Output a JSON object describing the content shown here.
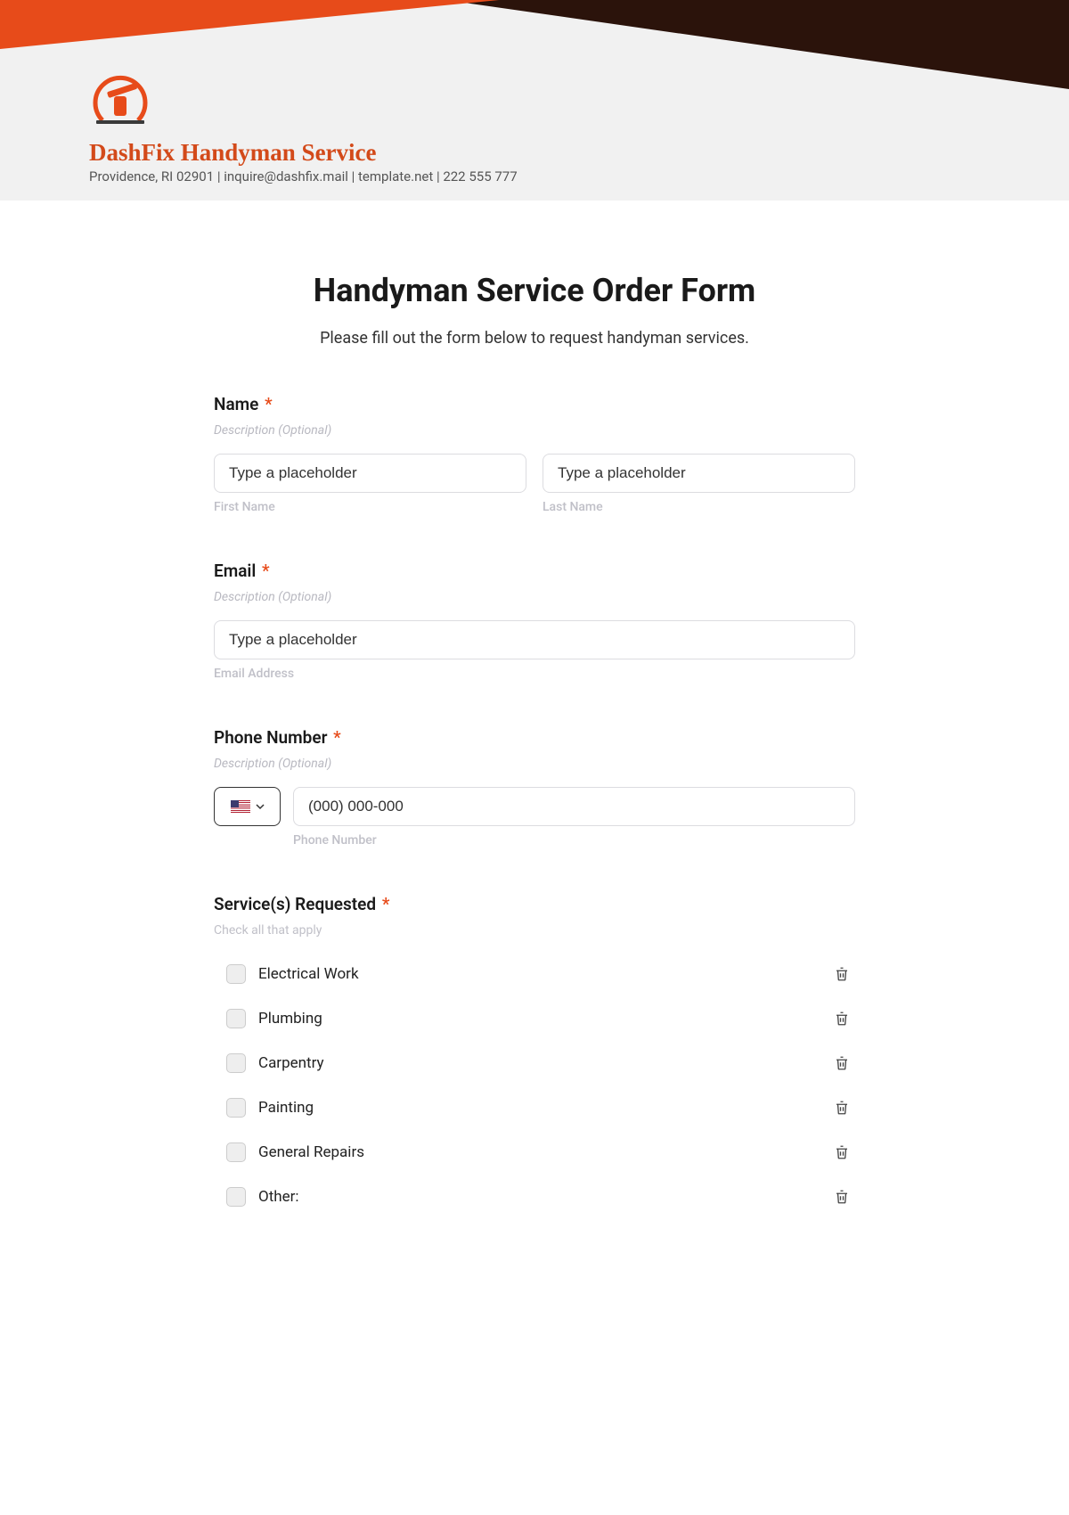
{
  "brand": {
    "name": "DashFix Handyman Service",
    "contact": "Providence, RI 02901 | inquire@dashfix.mail | template.net | 222 555 777"
  },
  "form": {
    "title": "Handyman Service Order Form",
    "subtitle": "Please fill out the form below to request handyman services."
  },
  "fields": {
    "name": {
      "label": "Name",
      "required_mark": "*",
      "desc": "Description (Optional)",
      "first_placeholder": "Type a placeholder",
      "last_placeholder": "Type a placeholder",
      "first_sub": "First Name",
      "last_sub": "Last Name"
    },
    "email": {
      "label": "Email",
      "required_mark": "*",
      "desc": "Description (Optional)",
      "placeholder": "Type a placeholder",
      "sub": "Email Address"
    },
    "phone": {
      "label": "Phone Number",
      "required_mark": "*",
      "desc": "Description (Optional)",
      "placeholder": "(000) 000-000",
      "sub": "Phone Number"
    },
    "services": {
      "label": "Service(s) Requested",
      "required_mark": "*",
      "hint": "Check all that apply",
      "options": [
        "Electrical Work",
        "Plumbing",
        "Carpentry",
        "Painting",
        "General Repairs",
        "Other:"
      ]
    }
  }
}
